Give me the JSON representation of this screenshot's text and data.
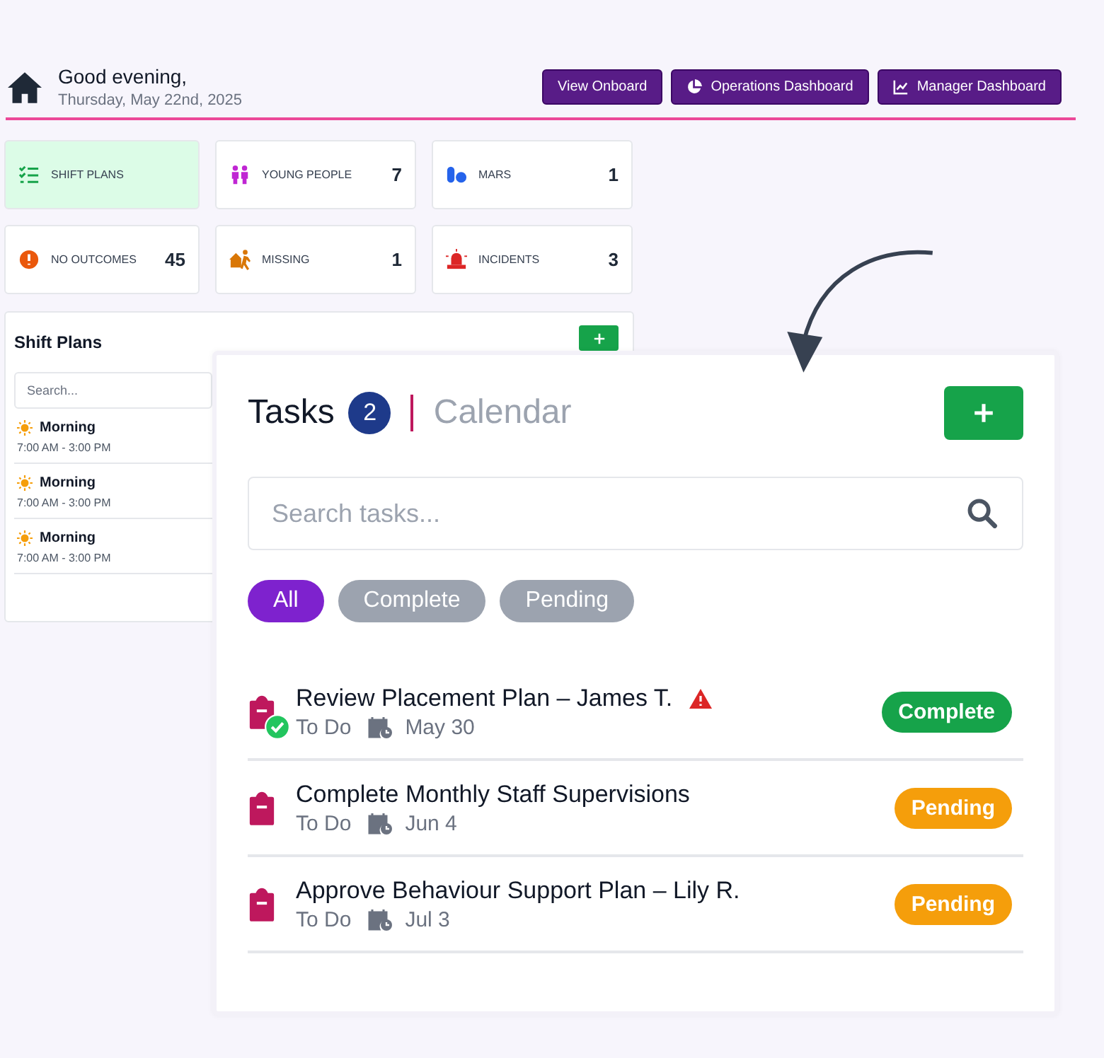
{
  "header": {
    "greeting": "Good evening,",
    "date": "Thursday, May 22nd, 2025"
  },
  "nav_buttons": [
    {
      "label": "View Onboard",
      "kind": "plain"
    },
    {
      "label": "Operations Dashboard",
      "kind": "pie"
    },
    {
      "label": "Manager Dashboard",
      "kind": "chart"
    }
  ],
  "stat_cards": [
    {
      "label": "SHIFT PLANS",
      "kind": "checklist",
      "selected": true
    },
    {
      "label": "YOUNG PEOPLE",
      "count": "7",
      "kind": "people",
      "selected": false
    },
    {
      "label": "MARS",
      "count": "1",
      "kind": "pills",
      "selected": false
    },
    {
      "label": "NO OUTCOMES",
      "count": "45",
      "kind": "alert",
      "selected": false
    },
    {
      "label": "MISSING",
      "count": "1",
      "kind": "runner",
      "selected": false
    },
    {
      "label": "INCIDENTS",
      "count": "3",
      "kind": "siren",
      "selected": false
    }
  ],
  "shift_plans": {
    "title": "Shift Plans",
    "search": {
      "placeholder": "Search..."
    },
    "items": [
      {
        "name": "Morning",
        "time": "7:00 AM - 3:00 PM"
      },
      {
        "name": "Morning",
        "time": "7:00 AM - 3:00 PM"
      },
      {
        "name": "Morning",
        "time": "7:00 AM - 3:00 PM"
      }
    ]
  },
  "tasks_panel": {
    "tabs": [
      {
        "label": "Tasks",
        "count": "2",
        "selected": true
      },
      {
        "label": "Calendar",
        "selected": false
      }
    ],
    "search": {
      "placeholder": "Search tasks..."
    },
    "filters": [
      {
        "label": "All",
        "selected": true
      },
      {
        "label": "Complete",
        "selected": false
      },
      {
        "label": "Pending",
        "selected": false
      }
    ],
    "tasks": [
      {
        "title": "Review Placement Plan – James T.",
        "warning": true,
        "done": true,
        "state": "To Do",
        "due": "May 30",
        "status": "Complete",
        "kind": "complete"
      },
      {
        "title": "Complete Monthly Staff Supervisions",
        "warning": false,
        "done": false,
        "state": "To Do",
        "due": "Jun 4",
        "status": "Pending",
        "kind": "pending"
      },
      {
        "title": "Approve Behaviour Support Plan – Lily R.",
        "warning": false,
        "done": false,
        "state": "To Do",
        "due": "Jul 3",
        "status": "Pending",
        "kind": "pending"
      }
    ]
  }
}
